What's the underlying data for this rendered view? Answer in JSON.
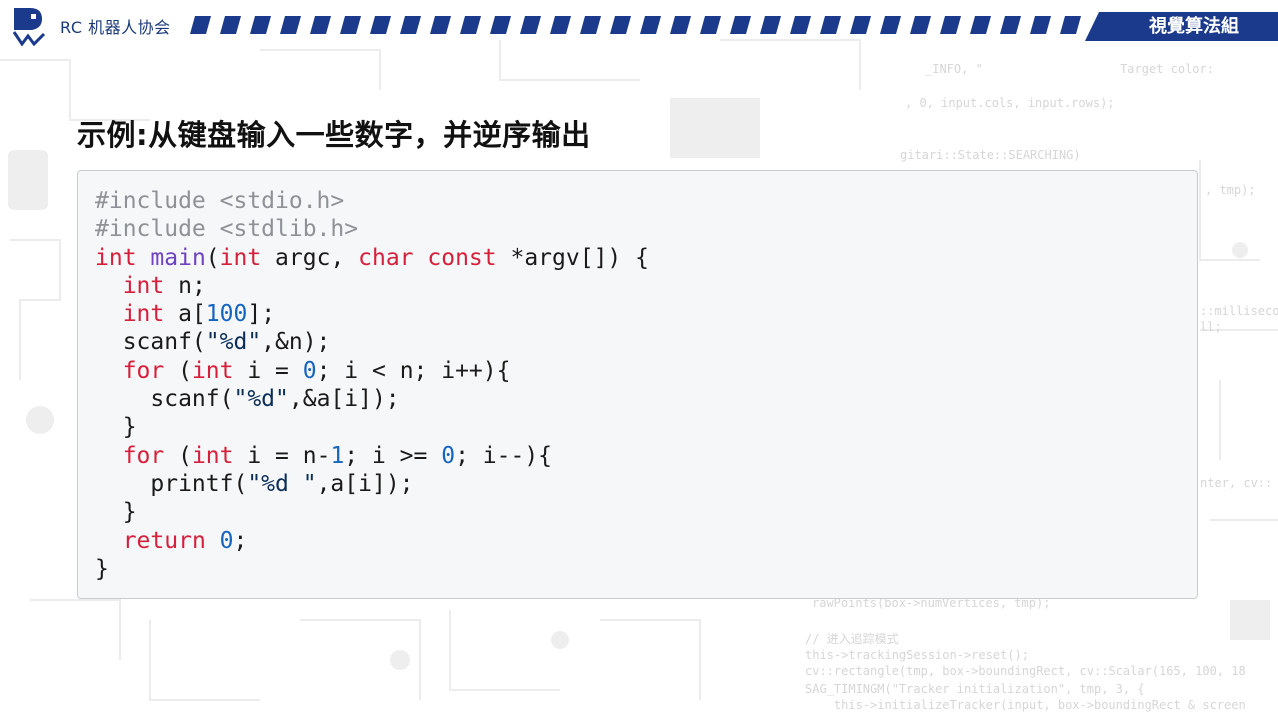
{
  "header": {
    "org_name": "RC 机器人协会",
    "group_name": "視覺算法組",
    "accent_color": "#1b3a8c",
    "logo_icon": "robot-logo-icon"
  },
  "slide": {
    "title": "示例:从键盘输入一些数字，并逆序输出"
  },
  "code_block": {
    "language": "c",
    "lines": [
      [
        {
          "t": "pre",
          "v": "#include <stdio.h>"
        }
      ],
      [
        {
          "t": "pre",
          "v": "#include <stdlib.h>"
        }
      ],
      [
        {
          "t": "kw",
          "v": "int"
        },
        {
          "t": "plain",
          "v": " "
        },
        {
          "t": "fn",
          "v": "main"
        },
        {
          "t": "plain",
          "v": "("
        },
        {
          "t": "kw",
          "v": "int"
        },
        {
          "t": "plain",
          "v": " argc, "
        },
        {
          "t": "kw",
          "v": "char"
        },
        {
          "t": "plain",
          "v": " "
        },
        {
          "t": "kw",
          "v": "const"
        },
        {
          "t": "plain",
          "v": " *argv[]) {"
        }
      ],
      [
        {
          "t": "plain",
          "v": "  "
        },
        {
          "t": "kw",
          "v": "int"
        },
        {
          "t": "plain",
          "v": " n;"
        }
      ],
      [
        {
          "t": "plain",
          "v": "  "
        },
        {
          "t": "kw",
          "v": "int"
        },
        {
          "t": "plain",
          "v": " a["
        },
        {
          "t": "num",
          "v": "100"
        },
        {
          "t": "plain",
          "v": "];"
        }
      ],
      [
        {
          "t": "plain",
          "v": "  scanf("
        },
        {
          "t": "str",
          "v": "\"%d\""
        },
        {
          "t": "plain",
          "v": ",&n);"
        }
      ],
      [
        {
          "t": "plain",
          "v": "  "
        },
        {
          "t": "kw",
          "v": "for"
        },
        {
          "t": "plain",
          "v": " ("
        },
        {
          "t": "kw",
          "v": "int"
        },
        {
          "t": "plain",
          "v": " i = "
        },
        {
          "t": "num",
          "v": "0"
        },
        {
          "t": "plain",
          "v": "; i < n; i++){"
        }
      ],
      [
        {
          "t": "plain",
          "v": "    scanf("
        },
        {
          "t": "str",
          "v": "\"%d\""
        },
        {
          "t": "plain",
          "v": ",&a[i]);"
        }
      ],
      [
        {
          "t": "plain",
          "v": "  }"
        }
      ],
      [
        {
          "t": "plain",
          "v": "  "
        },
        {
          "t": "kw",
          "v": "for"
        },
        {
          "t": "plain",
          "v": " ("
        },
        {
          "t": "kw",
          "v": "int"
        },
        {
          "t": "plain",
          "v": " i = n-"
        },
        {
          "t": "num",
          "v": "1"
        },
        {
          "t": "plain",
          "v": "; i >= "
        },
        {
          "t": "num",
          "v": "0"
        },
        {
          "t": "plain",
          "v": "; i--){"
        }
      ],
      [
        {
          "t": "plain",
          "v": "    printf("
        },
        {
          "t": "str",
          "v": "\"%d \""
        },
        {
          "t": "plain",
          "v": ",a[i]);"
        }
      ],
      [
        {
          "t": "plain",
          "v": "  }"
        }
      ],
      [
        {
          "t": "plain",
          "v": "  "
        },
        {
          "t": "kw",
          "v": "return"
        },
        {
          "t": "plain",
          "v": " "
        },
        {
          "t": "num",
          "v": "0"
        },
        {
          "t": "plain",
          "v": ";"
        }
      ],
      [
        {
          "t": "plain",
          "v": "}"
        }
      ]
    ]
  },
  "background_code": [
    "_INFO, \"                   Target color:",
    ", 0, input.cols, input.rows);",
    "gitari::State::SEARCHING)",
    ", tmp);",
    "::millisecon",
    "ll;",
    "nter, cv::",
    "rawPoints(box->numVertices, tmp);",
    "// 进入追踪模式",
    "this->trackingSession->reset();",
    "cv::rectangle(tmp, box->boundingRect, cv::Scalar(165, 100, 18",
    "SAG_TIMINGM(\"Tracker initialization\", tmp, 3, {",
    "    this->initializeTracker(input, box->boundingRect & screen"
  ]
}
